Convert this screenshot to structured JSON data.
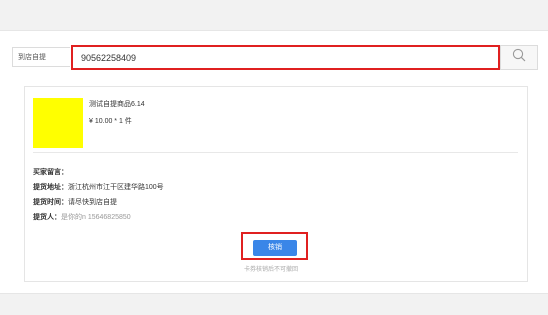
{
  "search": {
    "label": "到店自提",
    "value": "90562258409"
  },
  "order": {
    "product_name": "测试自提商品6.14",
    "price_qty": "¥ 10.00 * 1 件",
    "thumbnail_color": "#ffff00"
  },
  "details": {
    "buyer_message_label": "买家留言：",
    "address_label": "提货地址：",
    "address_value": "浙江杭州市江干区建华路100号",
    "time_label": "提货时间：",
    "time_value": "请尽快到店自提",
    "person_label": "提货人：",
    "person_value": "是你的n 15646825850"
  },
  "actions": {
    "verify_label": "核销",
    "verify_hint": "卡券核销后不可撤回"
  },
  "colors": {
    "highlight": "#e02020",
    "primary": "#3a86e8"
  }
}
